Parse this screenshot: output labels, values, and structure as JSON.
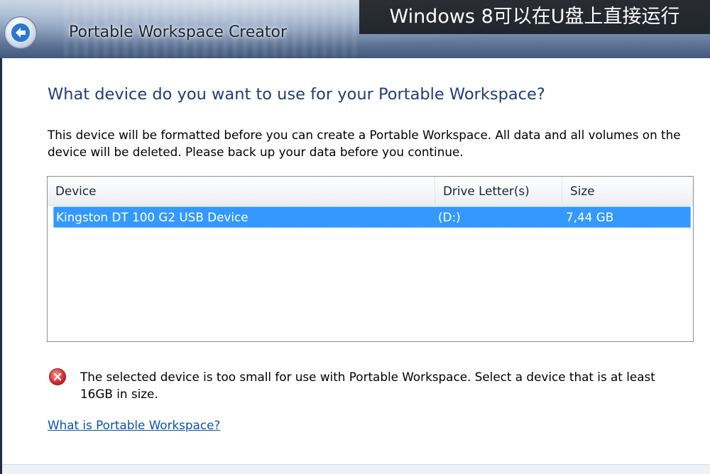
{
  "overlay_caption": "Windows 8可以在U盘上直接运行",
  "window": {
    "title": "Portable Workspace Creator",
    "back_icon": "back-arrow-icon"
  },
  "page": {
    "heading": "What device do you want to use for your Portable Workspace?",
    "description": "This device will be formatted before you can create a Portable Workspace. All data and all volumes on the device will be deleted. Please back up your data before you continue."
  },
  "device_list": {
    "columns": [
      "Device",
      "Drive Letter(s)",
      "Size"
    ],
    "rows": [
      {
        "device": "Kingston DT 100 G2 USB Device",
        "drive": "(D:)",
        "size": "7,44 GB",
        "selected": true
      }
    ]
  },
  "error": {
    "icon": "error-x-icon",
    "message": "The selected device is too small for use with Portable Workspace. Select a device that is at least 16GB in size."
  },
  "help_link": "What is Portable Workspace?",
  "colors": {
    "heading": "#1f3d7a",
    "selection": "#3399ff",
    "link": "#0a54b0",
    "error": "#d32a2a"
  }
}
